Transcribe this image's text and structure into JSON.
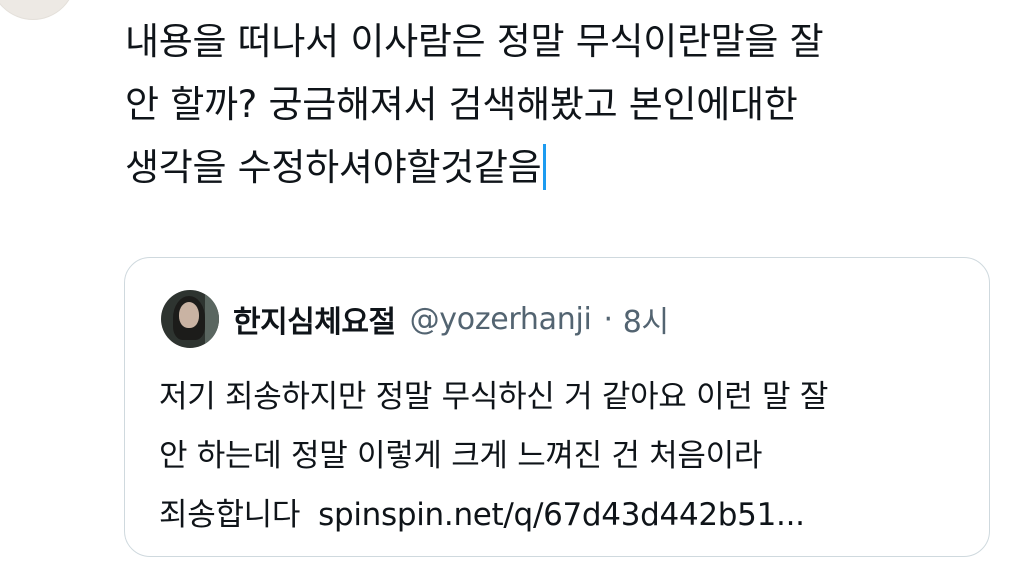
{
  "tweet": {
    "text_lines": [
      "내용을 떠나서 이사람은 정말 무식이란말을 잘",
      "안 할까? 궁금해져서 검색해봤고 본인에대한",
      "생각을 수정하셔야할것같음"
    ]
  },
  "quote": {
    "display_name": "한지심체요절",
    "handle": "@yozerhanji",
    "separator": "·",
    "time": "8시",
    "body_lines": [
      "저기 죄송하지만 정말 무식하신 거 같아요 이런 말 잘",
      "안 하는데 정말 이렇게 크게 느껴진 건 처음이라"
    ],
    "body_last": "죄송합니다",
    "link": "spinspin.net/q/67d43d442b51..."
  },
  "colors": {
    "caret": "#1d9bf0",
    "border": "#cfd9de",
    "secondary_text": "#536471"
  }
}
